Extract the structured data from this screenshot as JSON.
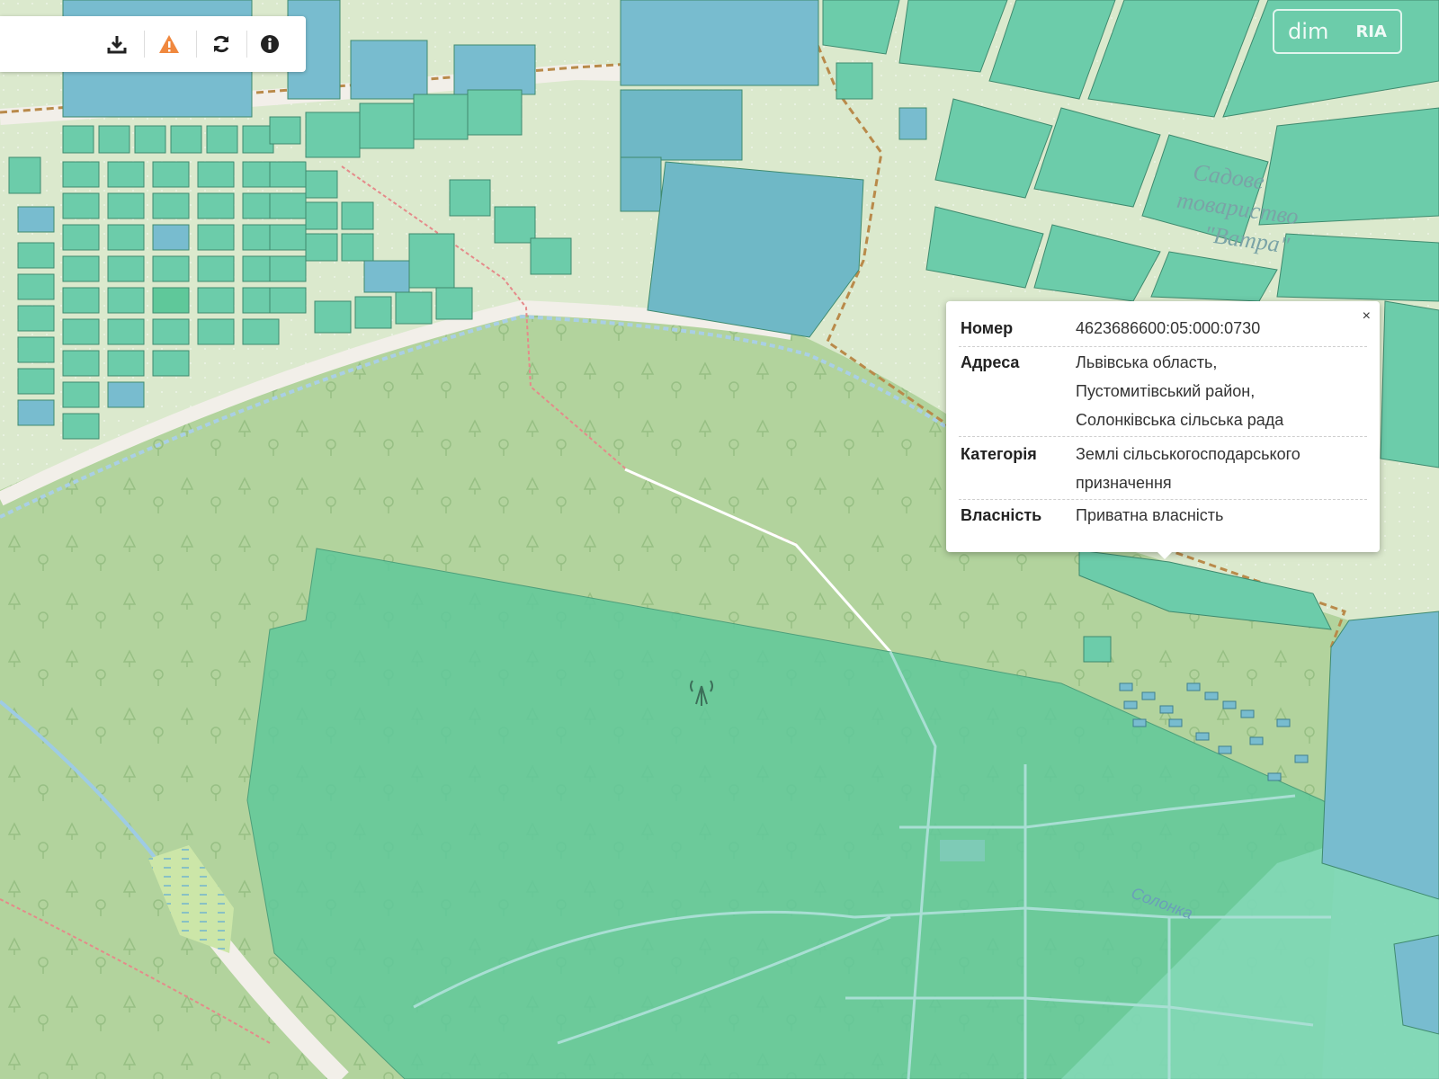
{
  "toolbar": {
    "tools": [
      "download-icon",
      "warning-icon",
      "refresh-icon",
      "info-icon"
    ],
    "warning_color": "#f0883e"
  },
  "watermark": {
    "left": "dim",
    "right": "RIA"
  },
  "map_labels": {
    "garden_line1": "Садове",
    "garden_line2": "товариство",
    "garden_line3": "\"Ватра\"",
    "stream": "Солонка"
  },
  "popup": {
    "close": "×",
    "rows": [
      {
        "key": "Номер",
        "lines": [
          "4623686600:05:000:0730"
        ]
      },
      {
        "key": "Адреса",
        "lines": [
          "Львівська область,",
          "Пустомитівський район,",
          "Солонківська сільська рада"
        ]
      },
      {
        "key": "Категорія",
        "lines": [
          "Землі сільськогосподарського",
          "призначення"
        ]
      },
      {
        "key": "Власність",
        "lines": [
          "Приватна власність"
        ]
      }
    ]
  },
  "colors": {
    "background": "#d7e8c8",
    "forest": "#aed19a",
    "selected_parcel": "#5fc89a",
    "parcel": "#6cccaa",
    "parcel_blue": "#78bccf",
    "road": "#f2efe9",
    "boundary": "#b98a4a"
  }
}
